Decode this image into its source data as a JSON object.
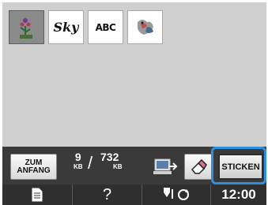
{
  "thumbnails": [
    {
      "name": "flower-pattern",
      "selected": true
    },
    {
      "name": "sky-text-pattern",
      "label": "Sky",
      "selected": false
    },
    {
      "name": "abc-text-pattern",
      "label": "ABC",
      "selected": false
    },
    {
      "name": "bird-pattern",
      "selected": false
    }
  ],
  "toolbar": {
    "zum_anfang_line1": "ZUM",
    "zum_anfang_line2": "ANFANG",
    "memory_used": "9",
    "memory_used_unit": "KB",
    "memory_total": "732",
    "memory_total_unit": "KB",
    "sticken_label": "STICKEN",
    "highlight_color": "#2d8fe0"
  },
  "statusbar": {
    "help_label": "?",
    "clock": "12:00"
  }
}
